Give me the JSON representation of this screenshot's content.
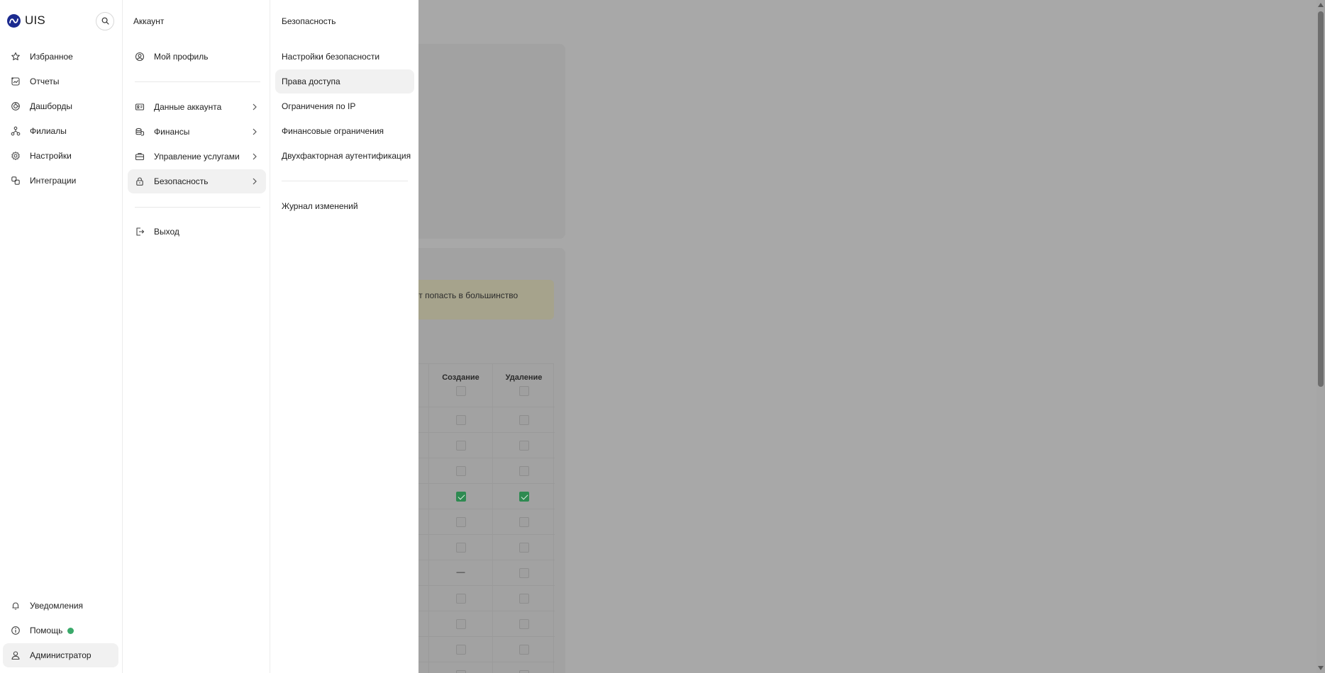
{
  "app": {
    "logo_text": "UIS"
  },
  "sidebar": {
    "search_icon": "search-icon",
    "items": [
      {
        "label": "Избранное",
        "icon": "star-icon"
      },
      {
        "label": "Отчеты",
        "icon": "reports-icon"
      },
      {
        "label": "Дашборды",
        "icon": "dashboard-icon"
      },
      {
        "label": "Филиалы",
        "icon": "branches-icon"
      },
      {
        "label": "Настройки",
        "icon": "gear-icon"
      },
      {
        "label": "Интеграции",
        "icon": "integrations-icon"
      }
    ],
    "bottom_items": [
      {
        "label": "Уведомления",
        "icon": "bell-icon"
      },
      {
        "label": "Помощь",
        "icon": "info-icon",
        "status_color": "#3aa96a"
      },
      {
        "label": "Администратор",
        "icon": "user-icon"
      }
    ]
  },
  "account_menu": {
    "title": "Аккаунт",
    "profile": {
      "label": "Мой профиль",
      "icon": "profile-icon"
    },
    "items": [
      {
        "label": "Данные аккаунта",
        "icon": "id-card-icon"
      },
      {
        "label": "Финансы",
        "icon": "coins-icon"
      },
      {
        "label": "Управление услугами",
        "icon": "briefcase-icon"
      },
      {
        "label": "Безопасность",
        "icon": "lock-icon"
      }
    ],
    "logout": {
      "label": "Выход",
      "icon": "logout-icon"
    }
  },
  "security_menu": {
    "title": "Безопасность",
    "items": [
      {
        "label": "Настройки безопасности"
      },
      {
        "label": "Права доступа"
      },
      {
        "label": "Ограничения по IP"
      },
      {
        "label": "Финансовые ограничения"
      },
      {
        "label": "Двухфакторная аутентификация"
      }
    ],
    "log": {
      "label": "Журнал изменений"
    }
  },
  "background": {
    "warning_text": "жет попасть в большинство",
    "table": {
      "headers": [
        "Создание",
        "Удаление"
      ],
      "rows": [
        [
          "off",
          "off"
        ],
        [
          "off",
          "off"
        ],
        [
          "off",
          "off"
        ],
        [
          "on",
          "on"
        ],
        [
          "off",
          "off"
        ],
        [
          "off",
          "off"
        ],
        [
          "—",
          "off"
        ],
        [
          "off",
          "off"
        ],
        [
          "off",
          "off"
        ],
        [
          "off",
          "off"
        ],
        [
          "off",
          "off"
        ]
      ]
    }
  },
  "colors": {
    "brand": "#1b2a8f",
    "check_on": "#2e8a51",
    "overlay": "#a8a8a8"
  }
}
